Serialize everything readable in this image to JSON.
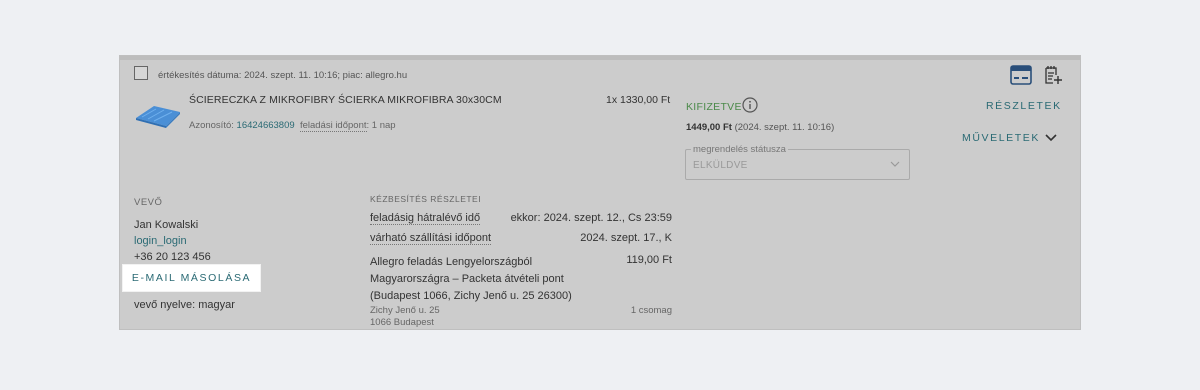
{
  "order": {
    "sale_date_label": "értékesítés dátuma:",
    "sale_date_value": "2024. szept. 11. 10:16; piac: allegro.hu",
    "product_title": "ŚCIERECZKA Z MIKROFIBRY ŚCIERKA MIKROFIBRA 30x30CM",
    "quantity_price": "1x 1330,00 Ft",
    "id_label": "Azonosító:",
    "id_value": "16424663809",
    "dispatch_label": "feladási időpont",
    "dispatch_value": ": 1 nap"
  },
  "payment": {
    "status": "KIFIZETVE",
    "total": "1449,00 Ft",
    "date": "(2024. szept. 11. 10:16)"
  },
  "order_status": {
    "legend": "megrendelés státusza",
    "value": "ELKÜLDVE"
  },
  "links": {
    "details": "RÉSZLETEK",
    "actions": "MŰVELETEK"
  },
  "buyer": {
    "heading": "VEVŐ",
    "name": "Jan Kowalski",
    "login": "login_login",
    "phone": "+36 20 123 456",
    "copy_email": "E-MAIL MÁSOLÁSA",
    "language": "vevő nyelve: magyar"
  },
  "shipping": {
    "heading": "KÉZBESÍTÉS RÉSZLETEI",
    "deadline_label": "feladásig hátralévő idő",
    "deadline_value": "ekkor: 2024. szept. 12., Cs 23:59",
    "expected_label": "várható szállítási időpont",
    "expected_value": "2024. szept. 17., K",
    "method": "Allegro feladás Lengyelországból Magyarországra – Packeta átvételi pont (Budapest 1066, Zichy Jenő u. 25 26300)",
    "method_price": "119,00 Ft",
    "address_line1": "Zichy Jenő u. 25",
    "address_line2": "1066 Budapest",
    "packages": "1 csomag"
  },
  "icons": {
    "invoice": "invoice-icon",
    "note": "note-icon",
    "info": "info-icon",
    "chevron": "chevron-down-icon"
  },
  "colors": {
    "accent": "#2a6a74",
    "paid": "#4c8a4a",
    "invoice_icon": "#2a4f7a"
  }
}
